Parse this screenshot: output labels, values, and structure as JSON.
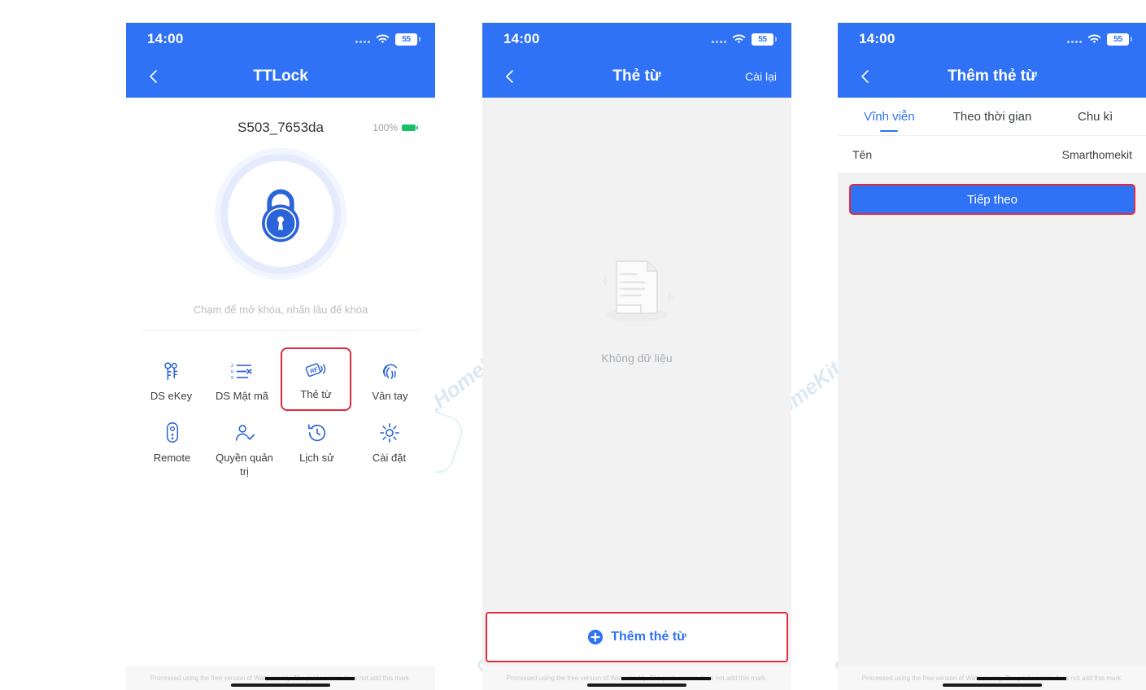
{
  "watermark": {
    "text": "SmartHomeKit",
    "color": "#dce9f2",
    "footer_note": "Processed using the free version of Watermarkly. The paid version does not add this mark."
  },
  "colors": {
    "brand_blue": "#2f72f5",
    "highlight_red": "#e02d3c",
    "content_gray": "#f2f2f2",
    "battery_green": "#18c06a"
  },
  "screen1": {
    "status": {
      "clock": "14:00",
      "battery_level": "55",
      "wifi_icon": "wifi-icon",
      "signal_icon": "signal-dots-icon"
    },
    "nav": {
      "back_icon": "back-arrow-icon",
      "title": "TTLock"
    },
    "device": {
      "name": "S503_7653da",
      "battery_percent": "100%",
      "battery_icon": "battery-full-icon"
    },
    "lock_button": {
      "icon": "padlock-icon",
      "hint": "Chạm để mở khóa, nhấn lâu để khóa"
    },
    "grid": [
      {
        "label": "DS eKey",
        "icon": "key-icon",
        "highlighted": false
      },
      {
        "label": "DS Mật mã",
        "icon": "passcode-list-icon",
        "highlighted": false
      },
      {
        "label": "Thẻ từ",
        "icon": "rf-card-icon",
        "highlighted": true
      },
      {
        "label": "Vân tay",
        "icon": "fingerprint-icon",
        "highlighted": false
      },
      {
        "label": "Remote",
        "icon": "remote-icon",
        "highlighted": false
      },
      {
        "label": "Quyền quản trị",
        "icon": "admin-user-icon",
        "highlighted": false
      },
      {
        "label": "Lịch sử",
        "icon": "history-clock-icon",
        "highlighted": false
      },
      {
        "label": "Cài đặt",
        "icon": "gear-icon",
        "highlighted": false
      }
    ]
  },
  "screen2": {
    "status": {
      "clock": "14:00",
      "battery_level": "55"
    },
    "nav": {
      "back_icon": "back-arrow-icon",
      "title": "Thẻ từ",
      "action": "Cài lại"
    },
    "empty": {
      "icon": "no-data-document-icon",
      "text": "Không dữ liệu"
    },
    "add_button": {
      "label": "Thêm thẻ từ",
      "icon": "plus-circle-icon",
      "highlighted": true
    }
  },
  "screen3": {
    "status": {
      "clock": "14:00",
      "battery_level": "55"
    },
    "nav": {
      "back_icon": "back-arrow-icon",
      "title": "Thêm thẻ từ"
    },
    "tabs": [
      {
        "label": "Vĩnh viễn",
        "active": true
      },
      {
        "label": "Theo thời gian",
        "active": false
      },
      {
        "label": "Chu kì",
        "active": false
      }
    ],
    "form": {
      "label": "Tên",
      "value": "Smarthomekit"
    },
    "next_button": {
      "label": "Tiếp theo",
      "highlighted": true
    }
  }
}
